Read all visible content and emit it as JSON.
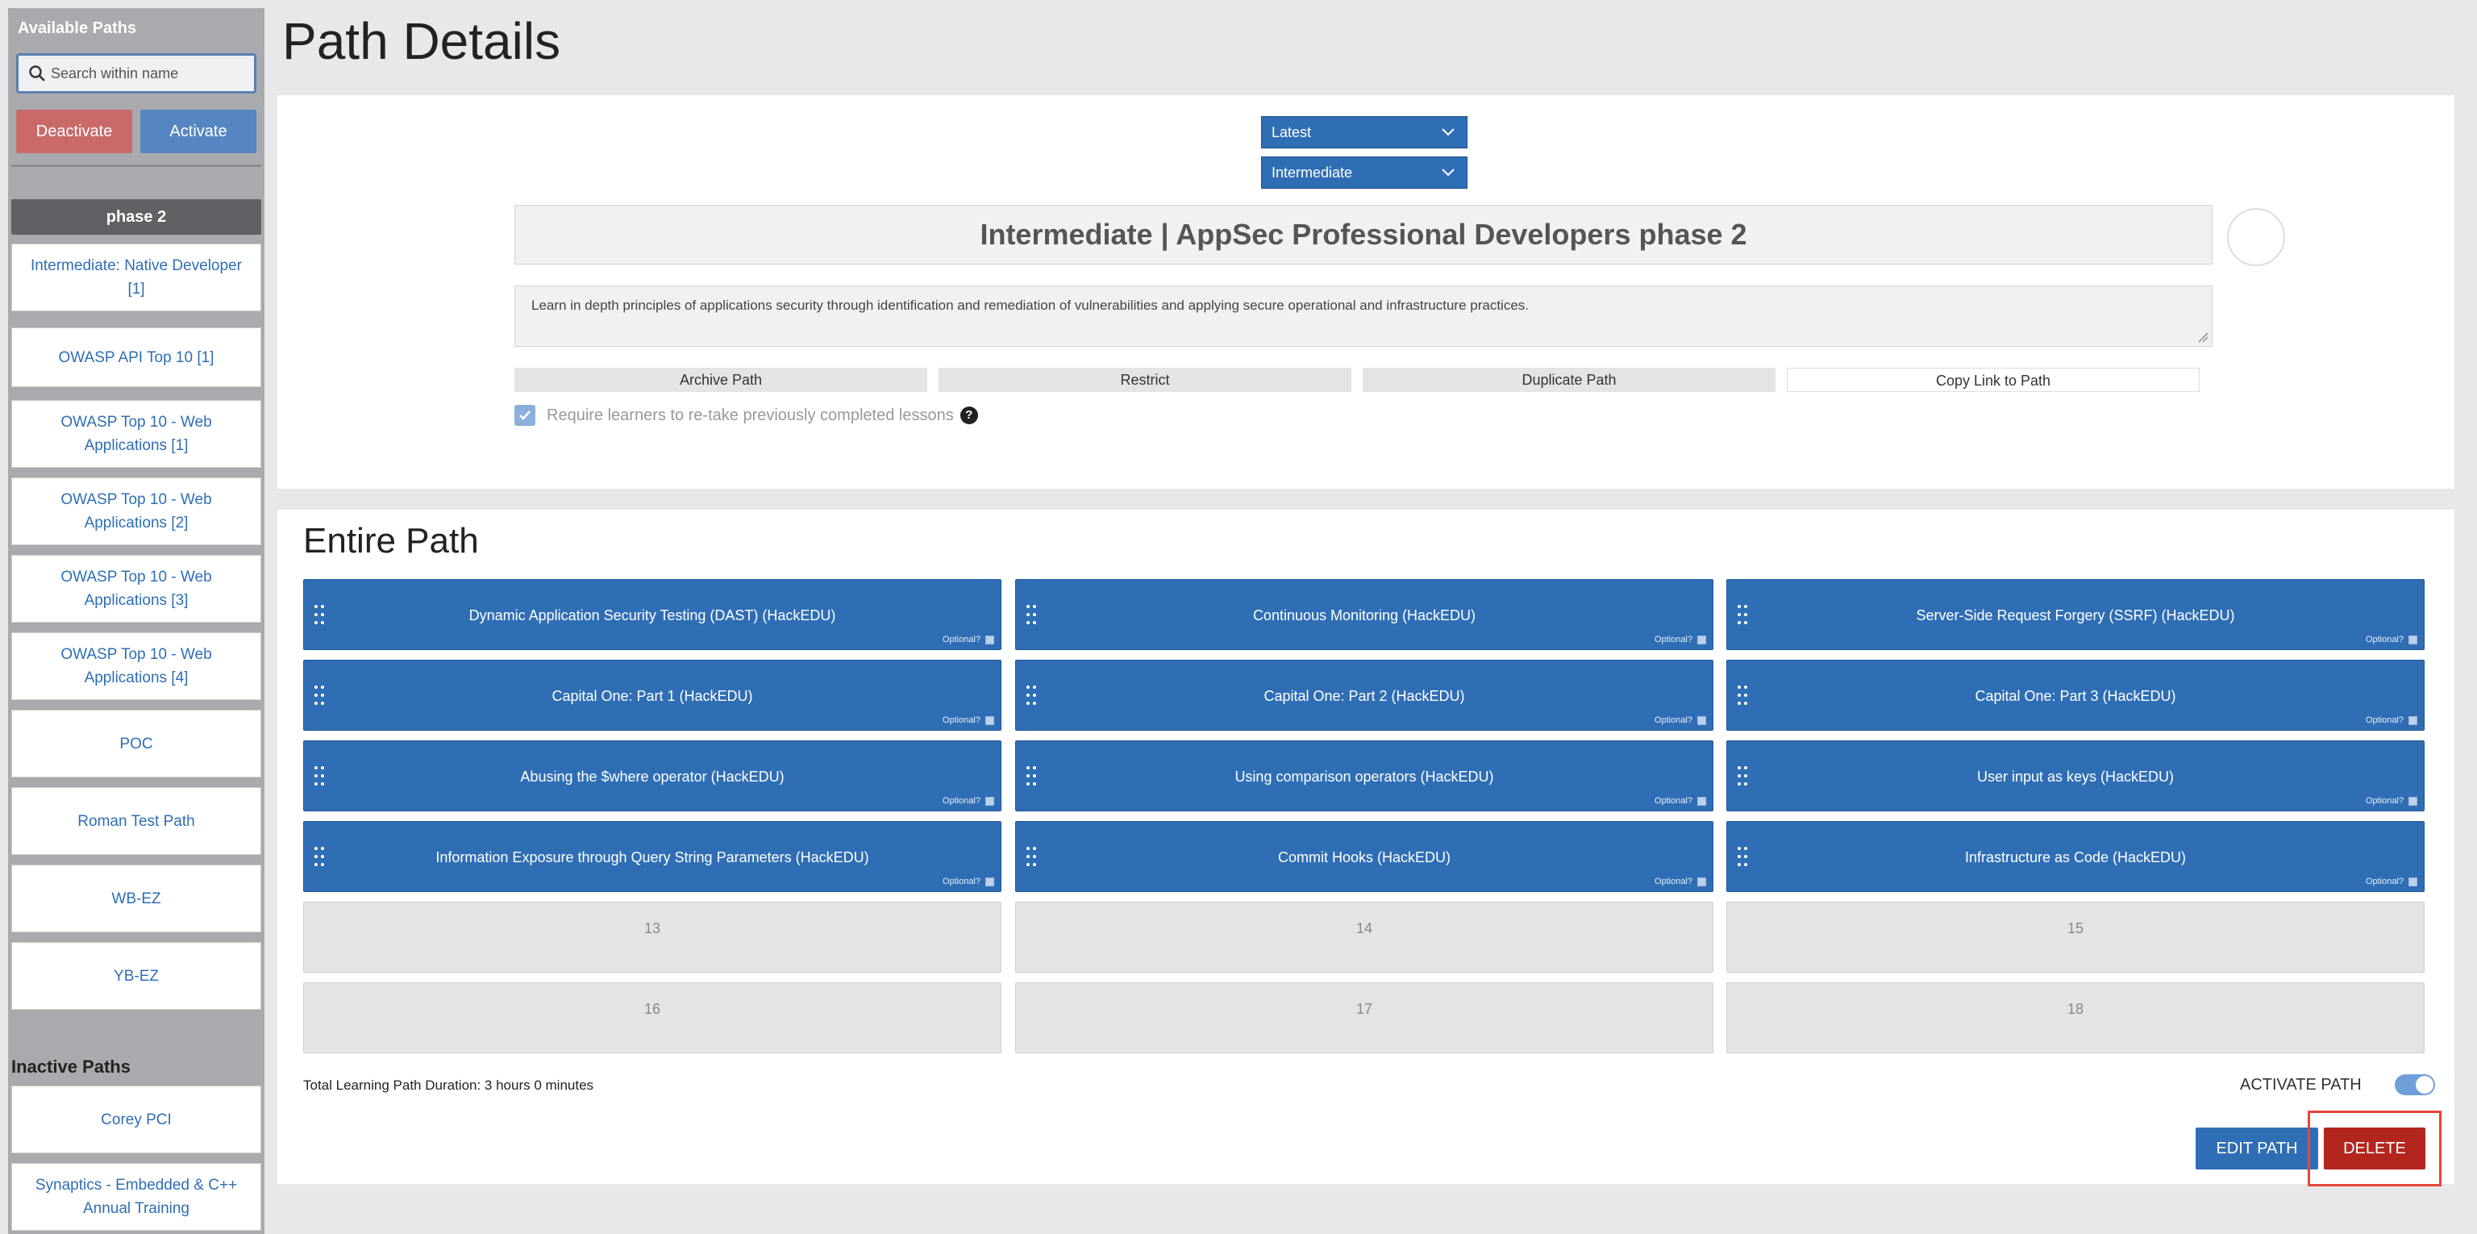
{
  "sidebar": {
    "title": "Available Paths",
    "search_placeholder": "Search within name",
    "deactivate_label": "Deactivate",
    "activate_label": "Activate",
    "selected_item": "phase 2",
    "items": [
      {
        "label": "Intermediate: Native Developer [1]"
      },
      {
        "label": "OWASP API Top 10 [1]"
      },
      {
        "label": "OWASP Top 10 - Web Applications [1]"
      },
      {
        "label": "OWASP Top 10 - Web Applications [2]"
      },
      {
        "label": "OWASP Top 10 - Web Applications [3]"
      },
      {
        "label": "OWASP Top 10 - Web Applications [4]"
      },
      {
        "label": "POC"
      },
      {
        "label": "Roman Test Path"
      },
      {
        "label": "WB-EZ"
      },
      {
        "label": "YB-EZ"
      }
    ],
    "inactive_title": "Inactive Paths",
    "inactive_items": [
      {
        "label": "Corey PCI"
      },
      {
        "label": "Synaptics - Embedded & C++ Annual Training"
      }
    ]
  },
  "page": {
    "title": "Path Details"
  },
  "details": {
    "version_select": "Latest",
    "level_select": "Intermediate",
    "path_title": "Intermediate | AppSec Professional Developers phase 2",
    "description": "Learn in depth principles of applications security through identification and remediation of vulnerabilities and applying secure operational and infrastructure practices.",
    "actions": {
      "archive": "Archive Path",
      "restrict": "Restrict",
      "duplicate": "Duplicate Path",
      "copy_link": "Copy Link to Path"
    },
    "require_retake_label": "Require learners to re-take previously completed lessons",
    "help_icon": "?"
  },
  "entire_path": {
    "title": "Entire Path",
    "optional_label": "Optional?",
    "lessons": [
      {
        "name": "Dynamic Application Security Testing (DAST) (HackEDU)"
      },
      {
        "name": "Continuous Monitoring (HackEDU)"
      },
      {
        "name": "Server-Side Request Forgery (SSRF) (HackEDU)"
      },
      {
        "name": "Capital One: Part 1 (HackEDU)"
      },
      {
        "name": "Capital One: Part 2 (HackEDU)"
      },
      {
        "name": "Capital One: Part 3 (HackEDU)"
      },
      {
        "name": "Abusing the $where operator (HackEDU)"
      },
      {
        "name": "Using comparison operators (HackEDU)"
      },
      {
        "name": "User input as keys (HackEDU)"
      },
      {
        "name": "Information Exposure through Query String Parameters (HackEDU)"
      },
      {
        "name": "Commit Hooks (HackEDU)"
      },
      {
        "name": "Infrastructure as Code (HackEDU)"
      }
    ],
    "empty_slots": [
      "13",
      "14",
      "15",
      "16",
      "17",
      "18"
    ],
    "duration": "Total Learning Path Duration: 3 hours 0 minutes",
    "activate_path_label": "ACTIVATE PATH",
    "activate_path_on": true,
    "edit_label": "EDIT PATH",
    "delete_label": "DELETE"
  },
  "colors": {
    "primary": "#2f6eb5",
    "danger": "#b3261e",
    "highlight": "#e2463a"
  }
}
